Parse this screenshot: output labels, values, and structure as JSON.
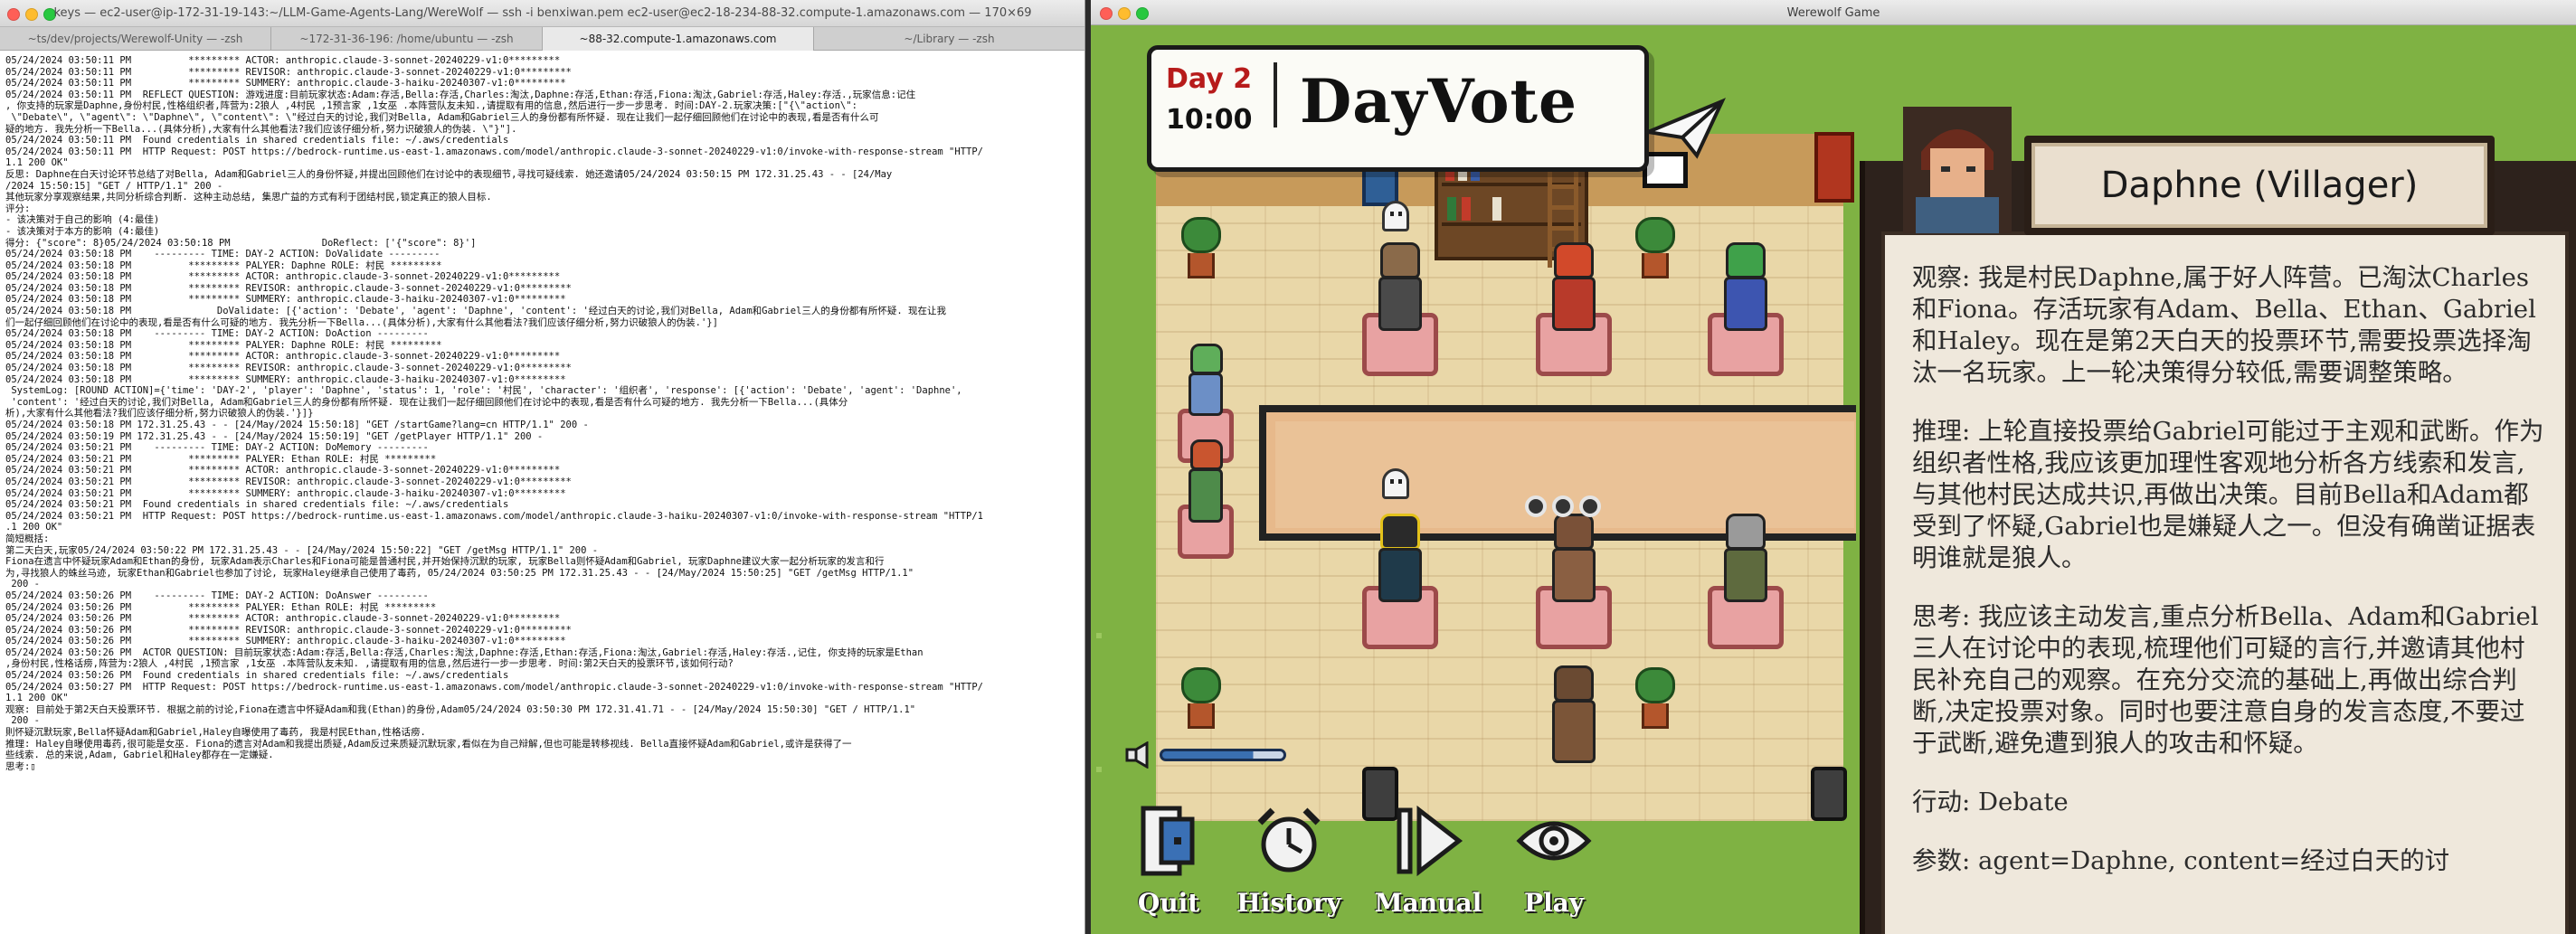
{
  "terminal": {
    "window_title": "keys — ec2-user@ip-172-31-19-143:~/LLM-Game-Agents-Lang/WereWolf — ssh -i benxiwan.pem ec2-user@ec2-18-234-88-32.compute-1.amazonaws.com — 170×69",
    "tabs": [
      "~ts/dev/projects/Werewolf-Unity — -zsh",
      "~172-31-36-196: /home/ubuntu — -zsh",
      "~88-32.compute-1.amazonaws.com",
      "~/Library — -zsh"
    ],
    "active_tab": 2,
    "lines": [
      "05/24/2024 03:50:11 PM          ********* ACTOR: anthropic.claude-3-sonnet-20240229-v1:0*********",
      "05/24/2024 03:50:11 PM          ********* REVISOR: anthropic.claude-3-sonnet-20240229-v1:0*********",
      "05/24/2024 03:50:11 PM          ********* SUMMERY: anthropic.claude-3-haiku-20240307-v1:0*********",
      "05/24/2024 03:50:11 PM  REFLECT QUESTION: 游戏进度:目前玩家状态:Adam:存活,Bella:存活,Charles:淘汰,Daphne:存活,Ethan:存活,Fiona:淘汰,Gabriel:存活,Haley:存活.,玩家信息:记住",
      ", 你支持的玩家是Daphne,身份村民,性格组织者,阵营为:2狼人 ,4村民 ,1预言家 ,1女巫 .本阵营队友未知.,请提取有用的信息,然后进行一步一步思考. 时间:DAY-2.玩家决策:[\"{\\\"action\\\":",
      " \\\"Debate\\\", \\\"agent\\\": \\\"Daphne\\\", \\\"content\\\": \\\"经过白天的讨论,我们对Bella, Adam和Gabriel三人的身份都有所怀疑. 现在让我们一起仔细回顾他们在讨论中的表现,看是否有什么可",
      "疑的地方. 我先分析一下Bella...(具体分析),大家有什么其他看法?我们应该仔细分析,努力识破狼人的伪装. \\\"}\"].",
      "05/24/2024 03:50:11 PM  Found credentials in shared credentials file: ~/.aws/credentials",
      "05/24/2024 03:50:11 PM  HTTP Request: POST https://bedrock-runtime.us-east-1.amazonaws.com/model/anthropic.claude-3-sonnet-20240229-v1:0/invoke-with-response-stream \"HTTP/",
      "1.1 200 OK\"",
      "反思: Daphne在白天讨论环节总结了对Bella, Adam和Gabriel三人的身份怀疑,并提出回顾他们在讨论中的表现细节,寻找可疑线索. 她还邀请05/24/2024 03:50:15 PM 172.31.25.43 - - [24/May",
      "/2024 15:50:15] \"GET / HTTP/1.1\" 200 -",
      "其他玩家分享观察结果,共同分析综合判断. 这种主动总结, 集思广益的方式有利于团结村民,锁定真正的狼人目标.",
      "",
      "评分:",
      "- 该决策对于自己的影响 (4:最佳)",
      "- 该决策对于本方的影响 (4:最佳)",
      "",
      "得分: {\"score\": 8}05/24/2024 03:50:18 PM                DoReflect: ['{\"score\": 8}']",
      "05/24/2024 03:50:18 PM    --------- TIME: DAY-2 ACTION: DoValidate ---------",
      "05/24/2024 03:50:18 PM          ********* PALYER: Daphne ROLE: 村民 *********",
      "05/24/2024 03:50:18 PM          ********* ACTOR: anthropic.claude-3-sonnet-20240229-v1:0*********",
      "05/24/2024 03:50:18 PM          ********* REVISOR: anthropic.claude-3-sonnet-20240229-v1:0*********",
      "05/24/2024 03:50:18 PM          ********* SUMMERY: anthropic.claude-3-haiku-20240307-v1:0*********",
      "05/24/2024 03:50:18 PM               DoValidate: [{'action': 'Debate', 'agent': 'Daphne', 'content': '经过白天的讨论,我们对Bella, Adam和Gabriel三人的身份都有所怀疑. 现在让我",
      "们一起仔细回顾他们在讨论中的表现,看是否有什么可疑的地方. 我先分析一下Bella...(具体分析),大家有什么其他看法?我们应该仔细分析,努力识破狼人的伪装.'}]",
      "05/24/2024 03:50:18 PM    --------- TIME: DAY-2 ACTION: DoAction ---------",
      "05/24/2024 03:50:18 PM          ********* PALYER: Daphne ROLE: 村民 *********",
      "05/24/2024 03:50:18 PM          ********* ACTOR: anthropic.claude-3-sonnet-20240229-v1:0*********",
      "05/24/2024 03:50:18 PM          ********* REVISOR: anthropic.claude-3-sonnet-20240229-v1:0*********",
      "05/24/2024 03:50:18 PM          ********* SUMMERY: anthropic.claude-3-haiku-20240307-v1:0*********",
      " SystemLog: [ROUND ACTION]={'time': 'DAY-2', 'player': 'Daphne', 'status': 1, 'role': '村民', 'character': '组织者', 'response': [{'action': 'Debate', 'agent': 'Daphne',",
      " 'content': '经过白天的讨论,我们对Bella, Adam和Gabriel三人的身份都有所怀疑. 现在让我们一起仔细回顾他们在讨论中的表现,看是否有什么可疑的地方. 我先分析一下Bella...(具体分",
      "析),大家有什么其他看法?我们应该仔细分析,努力识破狼人的伪装.'}]}",
      "",
      "05/24/2024 03:50:18 PM 172.31.25.43 - - [24/May/2024 15:50:18] \"GET /startGame?lang=cn HTTP/1.1\" 200 -",
      "05/24/2024 03:50:19 PM 172.31.25.43 - - [24/May/2024 15:50:19] \"GET /getPlayer HTTP/1.1\" 200 -",
      "05/24/2024 03:50:21 PM    --------- TIME: DAY-2 ACTION: DoMemory ---------",
      "05/24/2024 03:50:21 PM          ********* PALYER: Ethan ROLE: 村民 *********",
      "05/24/2024 03:50:21 PM          ********* ACTOR: anthropic.claude-3-sonnet-20240229-v1:0*********",
      "05/24/2024 03:50:21 PM          ********* REVISOR: anthropic.claude-3-sonnet-20240229-v1:0*********",
      "05/24/2024 03:50:21 PM          ********* SUMMERY: anthropic.claude-3-haiku-20240307-v1:0*********",
      "05/24/2024 03:50:21 PM  Found credentials in shared credentials file: ~/.aws/credentials",
      "05/24/2024 03:50:21 PM  HTTP Request: POST https://bedrock-runtime.us-east-1.amazonaws.com/model/anthropic.claude-3-haiku-20240307-v1:0/invoke-with-response-stream \"HTTP/1",
      ".1 200 OK\"",
      "简短概括:",
      "第二天白天,玩家05/24/2024 03:50:22 PM 172.31.25.43 - - [24/May/2024 15:50:22] \"GET /getMsg HTTP/1.1\" 200 -",
      "Fiona在遗言中怀疑玩家Adam和Ethan的身份, 玩家Adam表示Charles和Fiona可能是普通村民,并开始保持沉默的玩家, 玩家Bella则怀疑Adam和Gabriel, 玩家Daphne建议大家一起分析玩家的发言和行",
      "为,寻找狼人的蛛丝马迹, 玩家Ethan和Gabriel也参加了讨论, 玩家Haley继承自己使用了毒药, 05/24/2024 03:50:25 PM 172.31.25.43 - - [24/May/2024 15:50:25] \"GET /getMsg HTTP/1.1\"",
      " 200 -",
      "",
      "05/24/2024 03:50:26 PM    --------- TIME: DAY-2 ACTION: DoAnswer ---------",
      "05/24/2024 03:50:26 PM          ********* PALYER: Ethan ROLE: 村民 *********",
      "05/24/2024 03:50:26 PM          ********* ACTOR: anthropic.claude-3-sonnet-20240229-v1:0*********",
      "05/24/2024 03:50:26 PM          ********* REVISOR: anthropic.claude-3-sonnet-20240229-v1:0*********",
      "05/24/2024 03:50:26 PM          ********* SUMMERY: anthropic.claude-3-haiku-20240307-v1:0*********",
      "05/24/2024 03:50:26 PM  ACTOR QUESTION: 目前玩家状态:Adam:存活,Bella:存活,Charles:淘汰,Daphne:存活,Ethan:存活,Fiona:淘汰,Gabriel:存活,Haley:存活.,记住, 你支持的玩家是Ethan",
      ",身份村民,性格话痨,阵营为:2狼人 ,4村民 ,1预言家 ,1女巫 .本阵营队友未知. ,请提取有用的信息,然后进行一步一步思考. 时间:第2天白天的投票环节,该如何行动?",
      "05/24/2024 03:50:26 PM  Found credentials in shared credentials file: ~/.aws/credentials",
      "05/24/2024 03:50:27 PM  HTTP Request: POST https://bedrock-runtime.us-east-1.amazonaws.com/model/anthropic.claude-3-sonnet-20240229-v1:0/invoke-with-response-stream \"HTTP/",
      "1.1 200 OK\"",
      "观察: 目前处于第2天白天投票环节. 根据之前的讨论,Fiona在遗言中怀疑Adam和我(Ethan)的身份,Adam05/24/2024 03:50:30 PM 172.31.41.71 - - [24/May/2024 15:50:30] \"GET / HTTP/1.1\"",
      " 200 -",
      "則怀疑沉默玩家,Bella怀疑Adam和Gabriel,Haley自曝使用了毒药, 我是村民Ethan,性格话痨.",
      "",
      "推理: Haley自曝使用毒药,很可能是女巫. Fiona的遗言对Adam和我提出质疑,Adam反过来质疑沉默玩家,看似在为自己辩解,但也可能是转移视线. Bella直接怀疑Adam和Gabriel,或许是获得了一",
      "些线索. 总的来说,Adam, Gabriel和Haley都存在一定嫌疑.",
      "",
      "思考:▯"
    ]
  },
  "game": {
    "window_title": "Werewolf Game",
    "day_label": "Day 2",
    "time": "10:00",
    "phase": "DayVote",
    "player_name": "Daphne (Villager)",
    "panel_paragraphs": [
      "观察: 我是村民Daphne,属于好人阵营。已淘汰Charles和Fiona。存活玩家有Adam、Bella、Ethan、Gabriel和Haley。现在是第2天白天的投票环节,需要投票选择淘汰一名玩家。上一轮决策得分较低,需要调整策略。",
      "推理: 上轮直接投票给Gabriel可能过于主观和武断。作为组织者性格,我应该更加理性客观地分析各方线索和发言,与其他村民达成共识,再做出决策。目前Bella和Adam都受到了怀疑,Gabriel也是嫌疑人之一。但没有确凿证据表明谁就是狼人。",
      "思考: 我应该主动发言,重点分析Bella、Adam和Gabriel三人在讨论中的表现,梳理他们可疑的言行,并邀请其他村民补充自己的观察。在充分交流的基础上,再做出综合判断,决定投票对象。同时也要注意自身的发言态度,不要过于武断,避免遭到狼人的攻击和怀疑。",
      "行动: Debate",
      "参数: agent=Daphne, content=经过白天的讨"
    ],
    "toolbar": {
      "quit": "Quit",
      "history": "History",
      "manual": "Manual",
      "play": "Play"
    },
    "volume_level": 0.75,
    "icons": [
      "paper-plane-icon",
      "volume-icon",
      "quit-door-icon",
      "alarm-clock-icon",
      "step-play-icon",
      "eye-icon",
      "ghost-icon",
      "speech-dots-icon"
    ],
    "colors": {
      "day_red": "#b71b1b",
      "grass": "#7fb243",
      "panel_dark": "#2d221c",
      "panel_paper": "#efe8dc"
    }
  }
}
